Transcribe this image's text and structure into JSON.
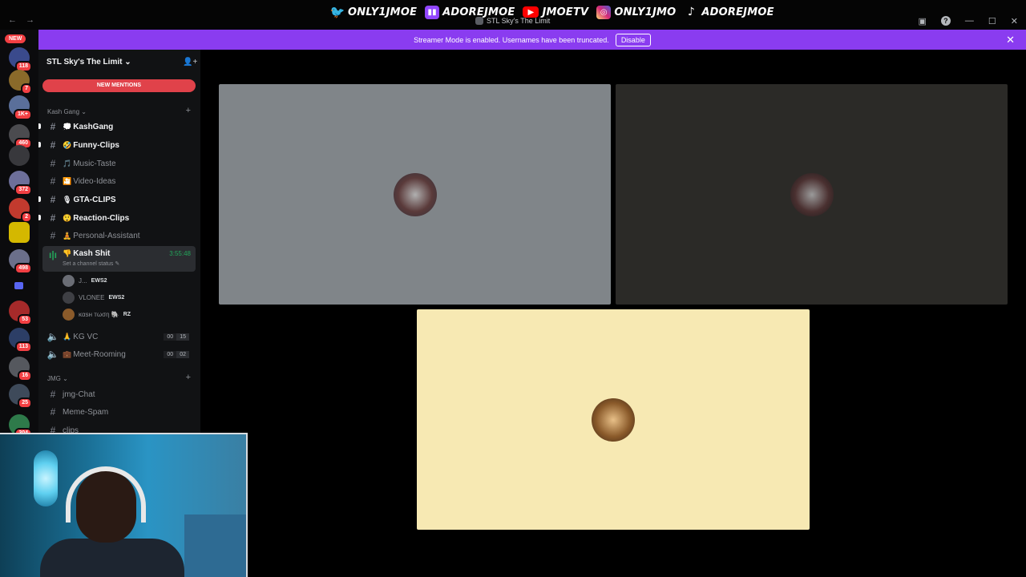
{
  "titlebar": {
    "back": "←",
    "forward": "→",
    "window_title": "STL Sky's The Limit",
    "socials": [
      {
        "icon": "twitter-icon",
        "glyph": "🐦",
        "handle": "ONLY1JMOE"
      },
      {
        "icon": "twitch-icon",
        "glyph": "▮▮",
        "handle": "ADOREJMOE"
      },
      {
        "icon": "youtube-icon",
        "glyph": "▶",
        "handle": "JMOETV"
      },
      {
        "icon": "instagram-icon",
        "glyph": "◎",
        "handle": "ONLY1JMO"
      },
      {
        "icon": "tiktok-icon",
        "glyph": "♪",
        "handle": "ADOREJMOE"
      }
    ],
    "controls": {
      "minimize": "—",
      "maximize": "☐",
      "close": "✕",
      "help": "?",
      "inbox": "▣"
    }
  },
  "guilds": {
    "new_label": "NEW",
    "servers": [
      {
        "badge": "118",
        "color": "#3a4a8c"
      },
      {
        "badge": "7",
        "color": "#8a6a2a"
      },
      {
        "badge": "1K+",
        "color": "#5a6f9a"
      },
      {
        "badge": "460",
        "color": "#4b4b4f"
      },
      {
        "badge": "",
        "color": "#38383c"
      },
      {
        "badge": "372",
        "color": "#6d6f9a"
      },
      {
        "badge": "2",
        "color": "#c23a2e"
      },
      {
        "badge": "",
        "color": "#d4b800"
      },
      {
        "badge": "498",
        "color": "#6b6f8a"
      },
      {
        "badge": "53",
        "color": "#a62a2a"
      },
      {
        "badge": "113",
        "color": "#2c3e66"
      },
      {
        "badge": "16",
        "color": "#55585e"
      },
      {
        "badge": "25",
        "color": "#3e4a5a"
      },
      {
        "badge": "304",
        "color": "#2e7a4a"
      }
    ]
  },
  "banner": {
    "text": "Streamer Mode is enabled. Usernames have been truncated.",
    "disable_label": "Disable",
    "close": "✕"
  },
  "sidebar": {
    "server_name": "STL Sky's The Limit",
    "chevron": "⌄",
    "new_mentions": "NEW MENTIONS",
    "categories": [
      {
        "label": "Kash Gang ⌄",
        "plus": "+"
      },
      {
        "label": "JMG ⌄",
        "plus": "+"
      }
    ],
    "channels": [
      {
        "emoji": "💭",
        "name": "KashGang"
      },
      {
        "emoji": "🤣",
        "name": "Funny-Clips"
      },
      {
        "emoji": "🎵",
        "name": "Music-Taste"
      },
      {
        "emoji": "🎦",
        "name": "Video-Ideas"
      },
      {
        "emoji": "🎙",
        "name": "GTA-CLIPS"
      },
      {
        "emoji": "😲",
        "name": "Reaction-Clips"
      },
      {
        "emoji": "🧘",
        "name": "Personal-Assistant"
      }
    ],
    "voice_active": {
      "emoji": "👎",
      "name": "Kash Shit",
      "timer": "3:55:48",
      "status": "Set a channel status ✎",
      "users": [
        {
          "name": "J...",
          "tag": "EWS2"
        },
        {
          "name": "VLONEE",
          "tag": "EWS2"
        },
        {
          "name": "ĸαѕн тωση 🐘",
          "tag": "RZ"
        }
      ]
    },
    "voice_channels": [
      {
        "emoji": "🙏",
        "name": "KG VC",
        "count_a": "00",
        "count_b": "15"
      },
      {
        "emoji": "💼",
        "name": "Meet-Rooming",
        "count_a": "00",
        "count_b": "02"
      }
    ],
    "jmg_channels": [
      "jmg-Chat",
      "Meme-Spam",
      "clips"
    ]
  },
  "stage": {
    "tiles": [
      {
        "name": "tile-1",
        "bg": "#808589",
        "avatar": "#5a3a3a"
      },
      {
        "name": "tile-2",
        "bg": "#2b2a27",
        "avatar": "#4a3030"
      },
      {
        "name": "tile-3",
        "bg": "#f7e9b3",
        "avatar": "#8a5a2a"
      }
    ]
  }
}
